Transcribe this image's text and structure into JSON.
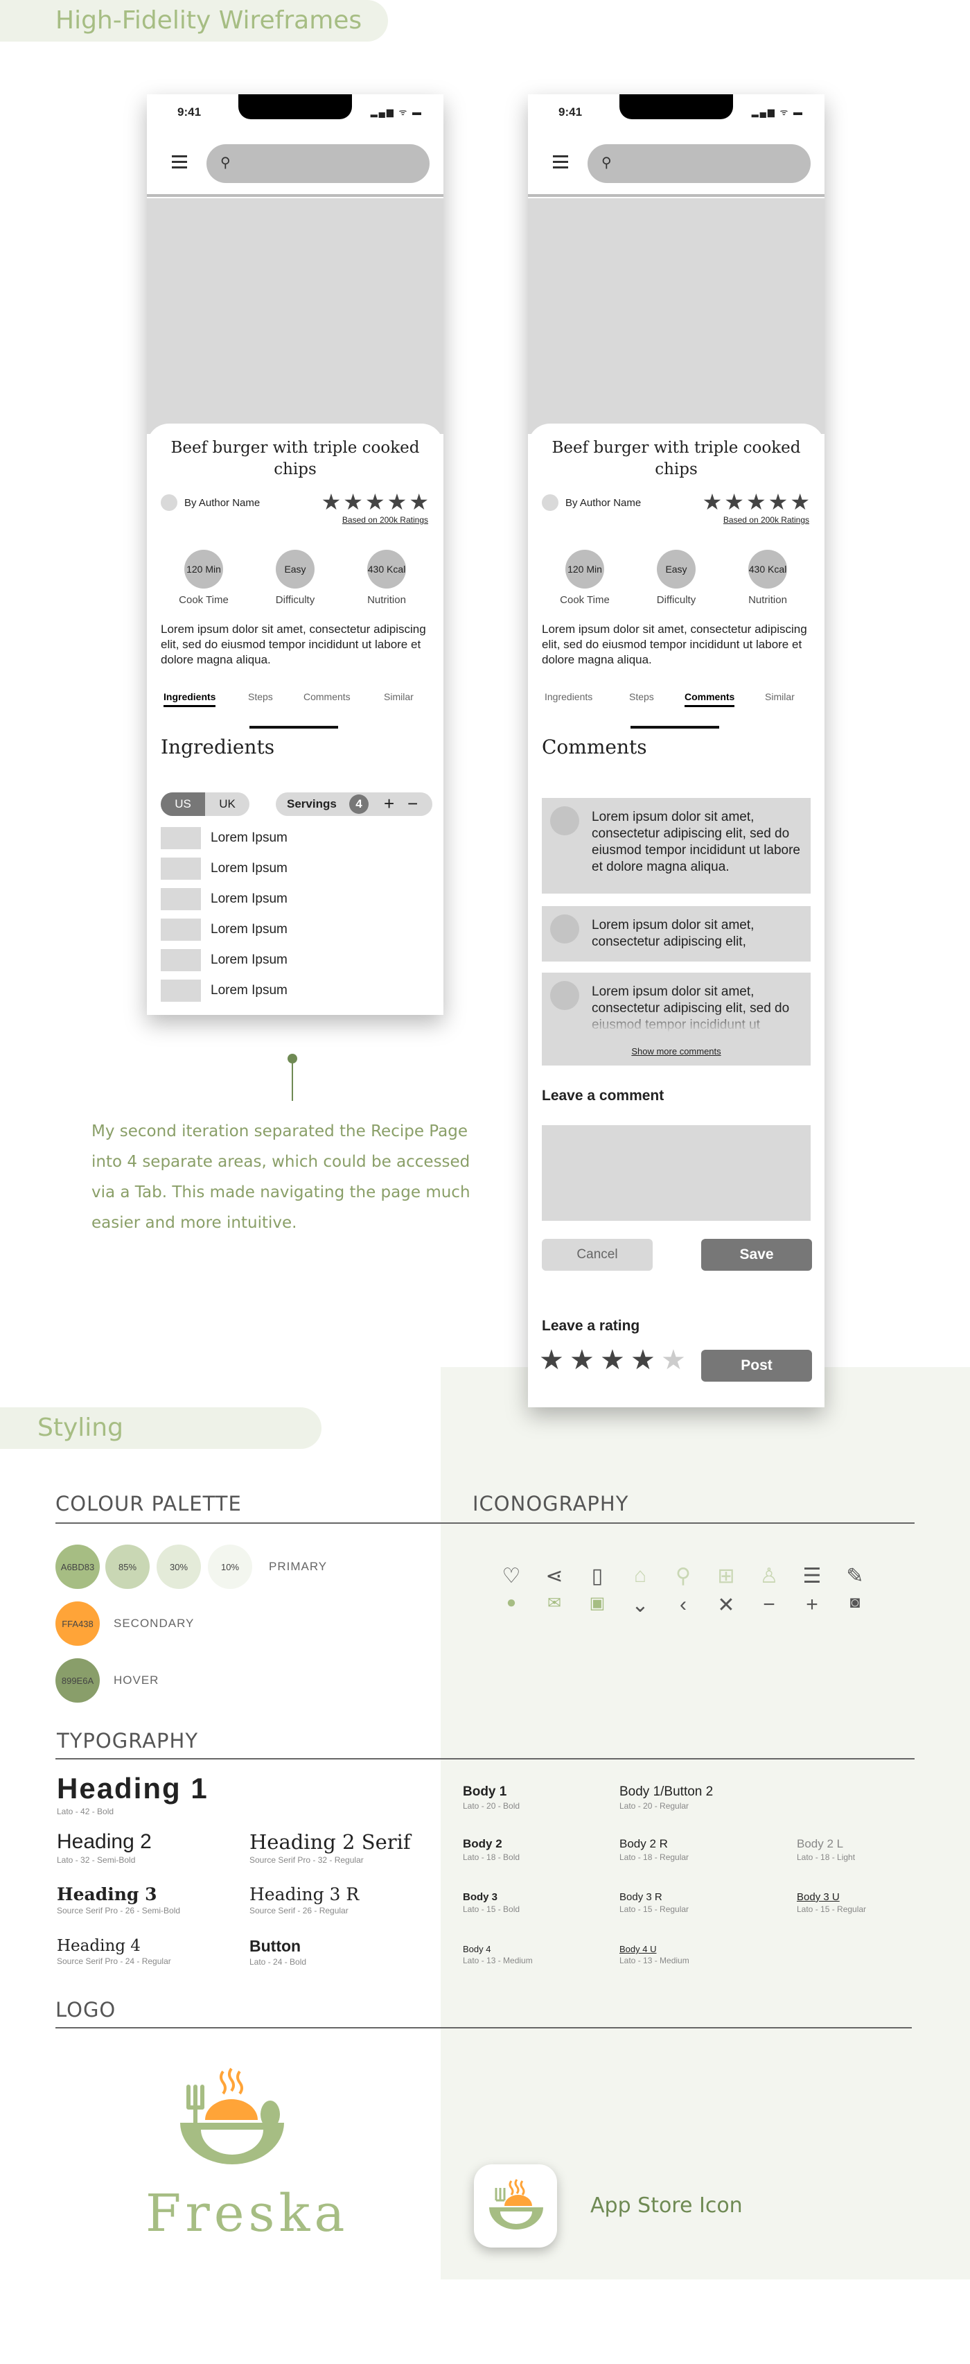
{
  "header": {
    "title": "High-Fidelity Wireframes"
  },
  "phone": {
    "time": "9:41",
    "recipe_title": "Beef burger with triple cooked chips",
    "author": "By Author Name",
    "rating_text": "Based on 200k Ratings",
    "stars": "★★★★★",
    "stats": [
      {
        "value": "120 Min",
        "label": "Cook Time"
      },
      {
        "value": "Easy",
        "label": "Difficulty"
      },
      {
        "value": "430 Kcal",
        "label": "Nutrition"
      }
    ],
    "description": "Lorem ipsum dolor sit amet, consectetur adipiscing elit, sed do eiusmod tempor incididunt ut labore et dolore magna aliqua.",
    "tabs": [
      "Ingredients",
      "Steps",
      "Comments",
      "Similar"
    ]
  },
  "phone1": {
    "section_title": "Ingredients",
    "unit_toggle": [
      "US",
      "UK"
    ],
    "servings_label": "Servings",
    "servings_value": "4",
    "ingredients": [
      "Lorem Ipsum",
      "Lorem Ipsum",
      "Lorem Ipsum",
      "Lorem Ipsum",
      "Lorem Ipsum",
      "Lorem Ipsum"
    ]
  },
  "phone2": {
    "section_title": "Comments",
    "comments": [
      "Lorem ipsum dolor sit amet, consectetur adipiscing elit, sed do eiusmod tempor incididunt ut labore et dolore magna aliqua.",
      "Lorem ipsum dolor sit amet, consectetur adipiscing elit,",
      "Lorem ipsum dolor sit amet, consectetur adipiscing elit, sed do eiusmod tempor incididunt ut"
    ],
    "show_more": "Show more comments",
    "leave_comment": "Leave a comment",
    "cancel": "Cancel",
    "save": "Save",
    "leave_rating": "Leave a rating",
    "rating_value": 4,
    "post": "Post"
  },
  "note": "My second iteration separated the Recipe Page into 4 separate areas, which could be accessed via a Tab. This made navigating the page much easier and more intuitive.",
  "styling": {
    "title": "Styling",
    "colour_palette": "COLOUR PALETTE",
    "iconography": "ICONOGRAPHY",
    "typography": "TYPOGRAPHY",
    "logo": "LOGO",
    "swatches": {
      "primary": [
        "A6BD83",
        "85%",
        "30%",
        "10%"
      ],
      "primary_label": "PRIMARY",
      "secondary": "FFA438",
      "secondary_label": "SECONDARY",
      "hover": "899E6A",
      "hover_label": "HOVER"
    },
    "colors": {
      "primary": "#a6bd83",
      "secondary": "#ffa438",
      "hover": "#899e6a"
    }
  },
  "icons": [
    "heart-icon",
    "share-icon",
    "bookmark-icon",
    "home-icon",
    "search-icon",
    "grid-icon",
    "user-icon",
    "menu-icon",
    "pencil-icon",
    "user-filled-icon",
    "mail-icon",
    "lock-icon",
    "chevron-down-icon",
    "chevron-left-icon",
    "close-icon",
    "minus-icon",
    "plus-icon",
    "camera-icon"
  ],
  "typography": {
    "h1": {
      "name": "Heading 1",
      "spec": "Lato - 42 - Bold"
    },
    "h2": {
      "name": "Heading 2",
      "spec": "Lato - 32 - Semi-Bold"
    },
    "h2s": {
      "name": "Heading 2 Serif",
      "spec": "Source Serif Pro - 32 - Regular"
    },
    "h3": {
      "name": "Heading 3",
      "spec": "Source Serif Pro - 26 - Semi-Bold"
    },
    "h3r": {
      "name": "Heading 3 R",
      "spec": "Source Serif - 26 - Regular"
    },
    "h4": {
      "name": "Heading 4",
      "spec": "Source Serif Pro - 24 - Regular"
    },
    "button": {
      "name": "Button",
      "spec": "Lato - 24 - Bold"
    },
    "b1": {
      "name": "Body 1",
      "spec": "Lato - 20 - Bold"
    },
    "b1b2": {
      "name": "Body 1/Button 2",
      "spec": "Lato - 20 - Regular"
    },
    "b2": {
      "name": "Body 2",
      "spec": "Lato - 18 - Bold"
    },
    "b2r": {
      "name": "Body 2 R",
      "spec": "Lato - 18 - Regular"
    },
    "b2l": {
      "name": "Body 2 L",
      "spec": "Lato - 18 - Light"
    },
    "b3": {
      "name": "Body 3",
      "spec": "Lato - 15 - Bold"
    },
    "b3r": {
      "name": "Body 3 R",
      "spec": "Lato - 15 - Regular"
    },
    "b3u": {
      "name": "Body 3 U",
      "spec": "Lato - 15 - Regular"
    },
    "b4": {
      "name": "Body 4",
      "spec": "Lato - 13 - Medium"
    },
    "b4u": {
      "name": "Body 4 U",
      "spec": "Lato - 13 - Medium"
    }
  },
  "logo": {
    "wordmark": "Freska",
    "app_icon_label": "App Store Icon"
  }
}
